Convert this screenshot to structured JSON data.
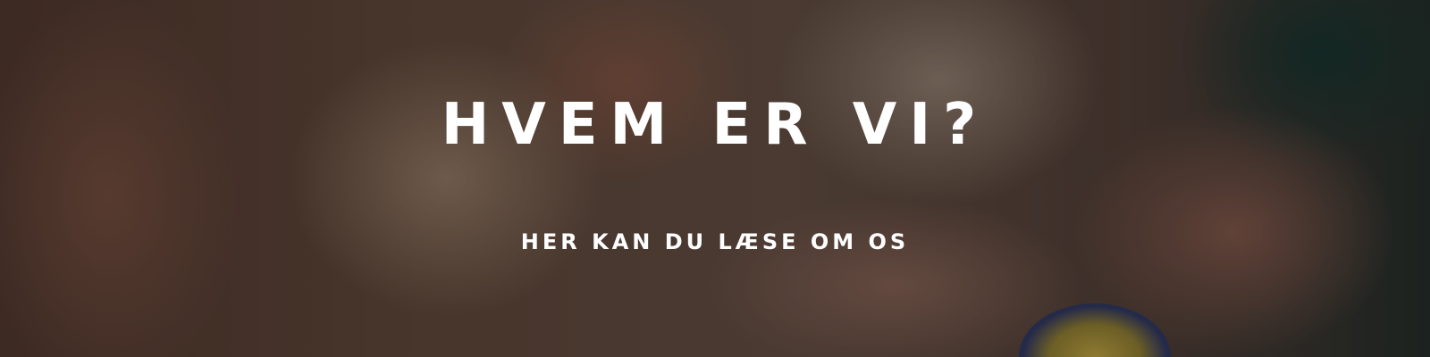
{
  "hero": {
    "title": "HVEM ER VI?",
    "subtitle": "HER KAN DU LÆSE OM OS",
    "background_image": "hands-holding-elderly-arm-photo"
  }
}
